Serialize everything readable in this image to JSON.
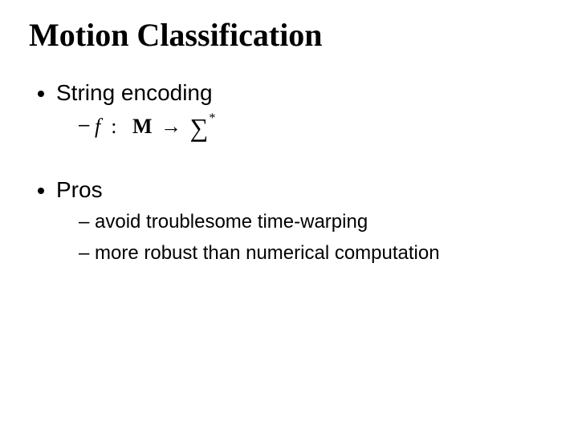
{
  "title": "Motion Classification",
  "bullets": {
    "b1": "String encoding",
    "formula": {
      "f": "f",
      "colon": ":",
      "M": "M",
      "arrow": "→",
      "sigma": "∑",
      "star": "*"
    },
    "b2": "Pros",
    "sub2a": "avoid troublesome time-warping",
    "sub2b": "more robust than numerical computation"
  }
}
